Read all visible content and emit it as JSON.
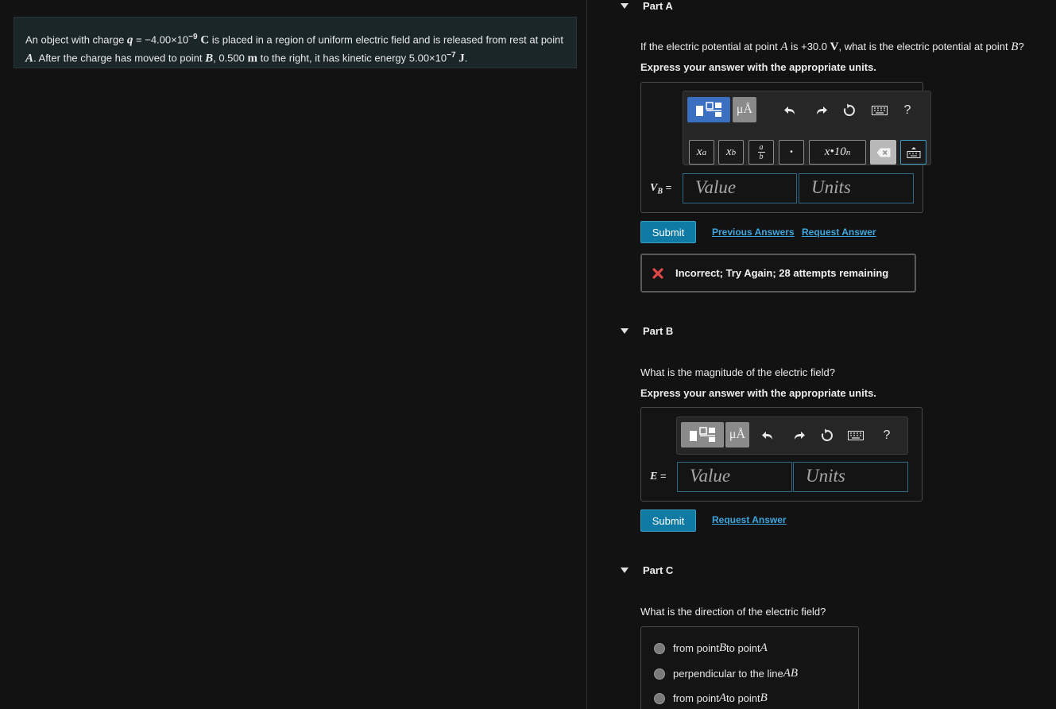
{
  "problem": {
    "t1": "An object with charge ",
    "q_sym": "q",
    "t2": " = −4.00×10",
    "q_exp": "−9",
    "q_unit": " C",
    "t3": " is placed in a region of uniform electric field and is released from rest at point",
    "a_sym": "A",
    "t4": ". After the charge has moved to point ",
    "b_sym": "B",
    "t5": ", 0.500 ",
    "m_unit": "m",
    "t6": " to the right, it has kinetic energy 5.00×10",
    "k_exp": "−7",
    "j_unit": " J",
    "t7": "."
  },
  "partA": {
    "title": "Part A",
    "q1": "If the electric potential at point ",
    "q_a": "A",
    "q2": " is +30.0 ",
    "q_v": "V",
    "q3": ", what is the electric potential at point ",
    "q_b": "B",
    "q4": "?",
    "instruction": "Express your answer with the appropriate units.",
    "label": "V",
    "label_sub": "B",
    "label_eq": " =",
    "value_placeholder": "Value",
    "units_placeholder": "Units",
    "submit": "Submit",
    "previous_answers": "Previous Answers",
    "request_answer": "Request Answer",
    "feedback": "Incorrect; Try Again; 28 attempts remaining",
    "mu_label": "μÅ",
    "help_label": "?",
    "sup_label": "x",
    "sup_exp": "a",
    "sub_label": "x",
    "sub_sub": "b",
    "frac_num": "a",
    "frac_den": "b",
    "dot_label": "•",
    "sci_label": "x•10",
    "sci_exp": "n"
  },
  "partB": {
    "title": "Part B",
    "question": "What is the magnitude of the electric field?",
    "instruction": "Express your answer with the appropriate units.",
    "label": "E",
    "label_eq": " =",
    "value_placeholder": "Value",
    "units_placeholder": "Units",
    "submit": "Submit",
    "request_answer": "Request Answer",
    "mu_label": "μÅ",
    "help_label": "?"
  },
  "partC": {
    "title": "Part C",
    "question": "What is the direction of the electric field?",
    "options": [
      {
        "pre": "from point ",
        "s1": "B",
        "mid": " to point ",
        "s2": "A"
      },
      {
        "pre": "perpendicular to the line ",
        "s1": "AB",
        "mid": "",
        "s2": ""
      },
      {
        "pre": "from point ",
        "s1": "A",
        "mid": " to point ",
        "s2": "B"
      }
    ]
  },
  "colors": {
    "accent": "#0f7aa3",
    "link": "#3ea6de",
    "error": "#e04848",
    "template_blue": "#3b6fc2"
  }
}
